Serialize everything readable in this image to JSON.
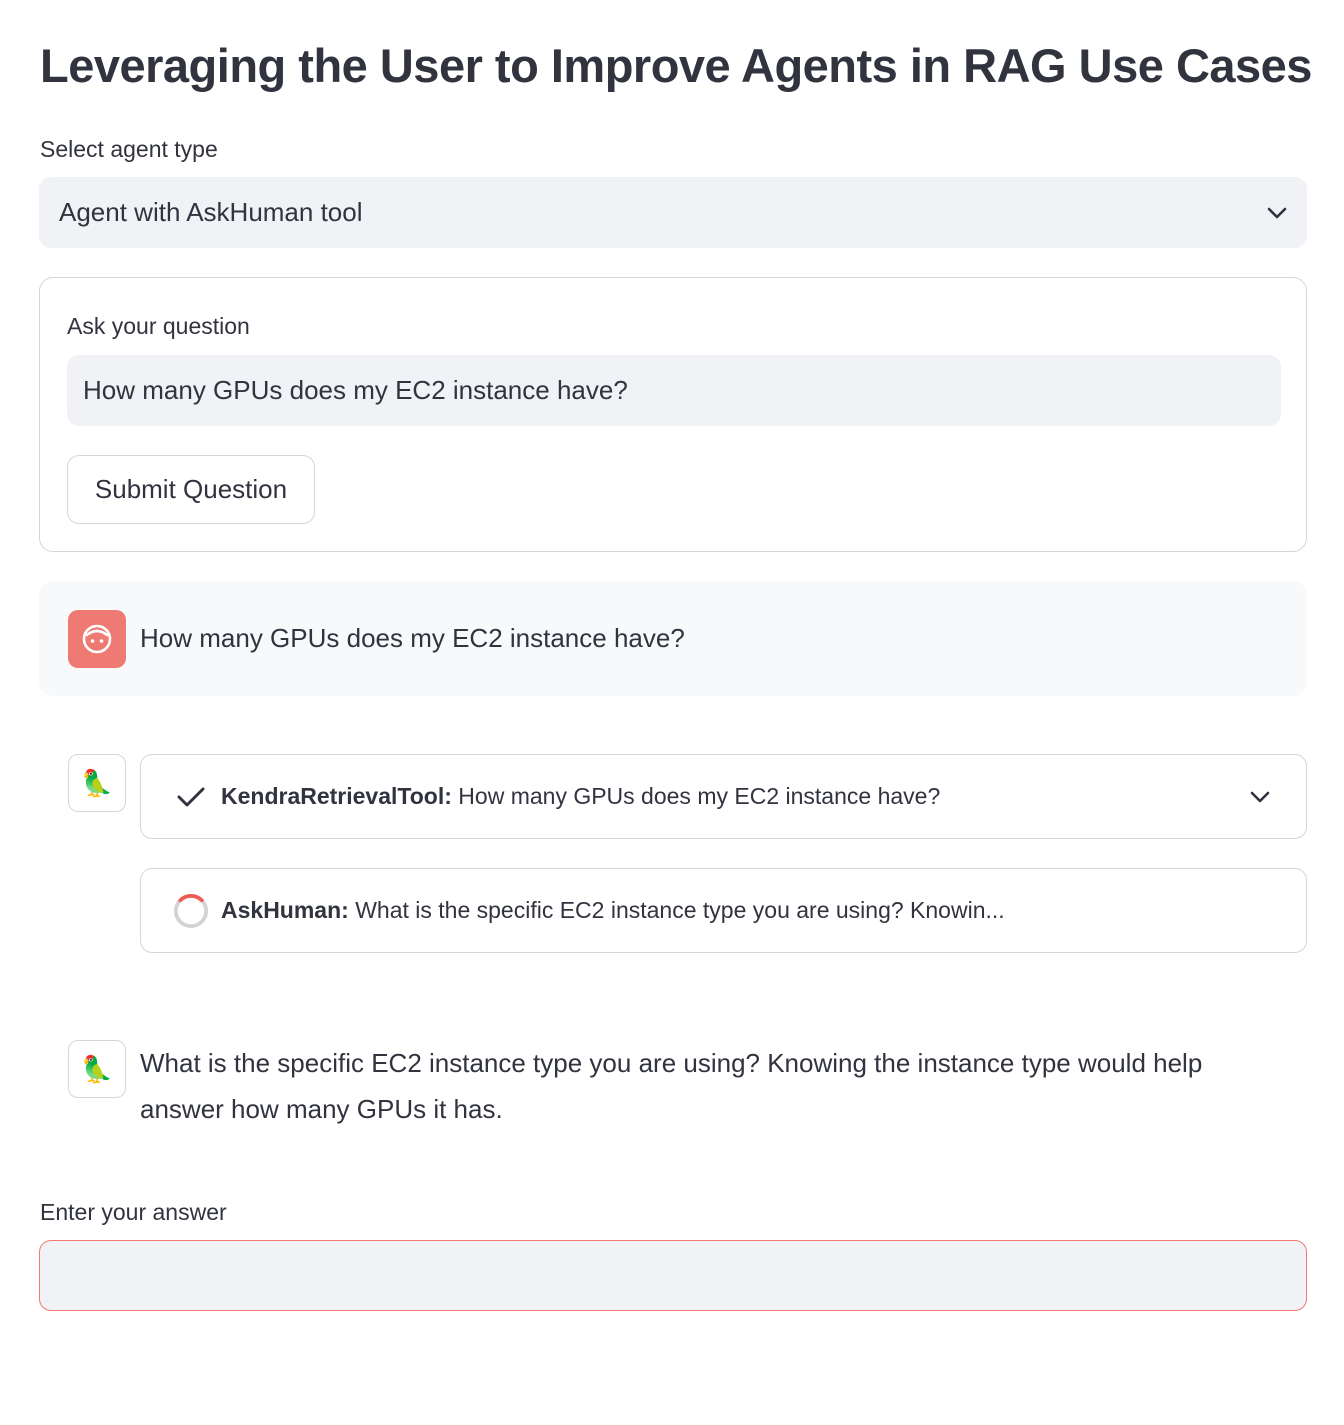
{
  "page": {
    "title": "Leveraging the User to Improve Agents in RAG Use Cases"
  },
  "agent_select": {
    "label": "Select agent type",
    "selected": "Agent with AskHuman tool"
  },
  "question_form": {
    "label": "Ask your question",
    "input_value": "How many GPUs does my EC2 instance have?",
    "submit_label": "Submit Question"
  },
  "chat": {
    "user_message": "How many GPUs does my EC2 instance have?",
    "steps": [
      {
        "status": "complete",
        "tool": "KendraRetrievalTool:",
        "text": " How many GPUs does my EC2 instance have?"
      },
      {
        "status": "running",
        "tool": "AskHuman:",
        "text": " What is the specific EC2 instance type you are using? Knowin..."
      }
    ],
    "assistant_message": "What is the specific EC2 instance type you are using? Knowing the instance type would help answer how many GPUs it has.",
    "bot_avatar_glyph": "🦜"
  },
  "answer_form": {
    "label": "Enter your answer",
    "value": ""
  },
  "colors": {
    "text": "#31333f",
    "input_bg": "#f0f2f6",
    "border": "#d6d6d9",
    "user_avatar": "#ee7a73",
    "error_border": "#ee7a73"
  }
}
